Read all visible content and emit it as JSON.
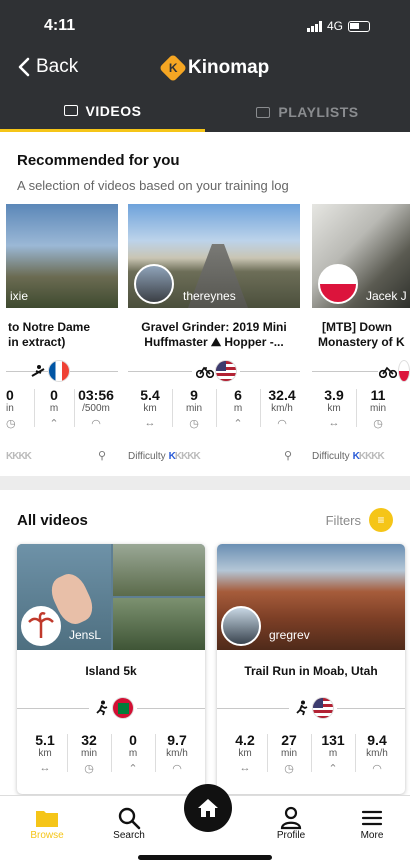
{
  "status": {
    "time": "4:11",
    "network": "4G"
  },
  "nav": {
    "back_label": "Back",
    "app_name": "Kinomap"
  },
  "tabs": [
    {
      "label": "VIDEOS",
      "active": true
    },
    {
      "label": "PLAYLISTS",
      "active": false
    }
  ],
  "recommended": {
    "title": "Recommended for you",
    "subtitle": "A selection of videos based on your training log",
    "difficulty_label": "Difficulty",
    "cards": [
      {
        "author": "ixie",
        "title_line1": "to Notre Dame",
        "title_line2": "in extract)",
        "stats": [
          {
            "value": "0",
            "unit": "in"
          },
          {
            "value": "0",
            "unit": "m"
          },
          {
            "value": "03:56",
            "unit": "/500m"
          }
        ]
      },
      {
        "author": "thereynes",
        "title_line1": "Gravel Grinder: 2019 Mini",
        "title_line2": "Huffmaster ⛰ Hopper -...",
        "stats": [
          {
            "value": "5.4",
            "unit": "km"
          },
          {
            "value": "9",
            "unit": "min"
          },
          {
            "value": "6",
            "unit": "m"
          },
          {
            "value": "32.4",
            "unit": "km/h"
          }
        ]
      },
      {
        "author": "Jacek J",
        "title_line1": "[MTB] Down",
        "title_line2": "Monastery of K",
        "stats": [
          {
            "value": "3.9",
            "unit": "km"
          },
          {
            "value": "11",
            "unit": "min"
          }
        ]
      }
    ]
  },
  "all_videos": {
    "title": "All videos",
    "filters_label": "Filters",
    "cards": [
      {
        "author": "JensL",
        "title": "Island 5k",
        "stats": [
          {
            "value": "5.1",
            "unit": "km"
          },
          {
            "value": "32",
            "unit": "min"
          },
          {
            "value": "0",
            "unit": "m"
          },
          {
            "value": "9.7",
            "unit": "km/h"
          }
        ]
      },
      {
        "author": "gregrev",
        "title": "Trail Run in Moab, Utah",
        "stats": [
          {
            "value": "4.2",
            "unit": "km"
          },
          {
            "value": "27",
            "unit": "min"
          },
          {
            "value": "131",
            "unit": "m"
          },
          {
            "value": "9.4",
            "unit": "km/h"
          }
        ]
      }
    ]
  },
  "bottom_nav": [
    {
      "label": "Browse",
      "icon": "folder-icon",
      "active": true
    },
    {
      "label": "Search",
      "icon": "search-icon"
    },
    {
      "label": "",
      "icon": "home-icon"
    },
    {
      "label": "Profile",
      "icon": "profile-icon"
    },
    {
      "label": "More",
      "icon": "menu-icon"
    }
  ],
  "colors": {
    "accent": "#f5c518",
    "header_bg": "#2f3134",
    "browse_active": "#f5c518"
  }
}
